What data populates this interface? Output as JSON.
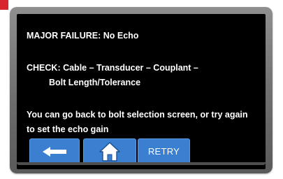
{
  "message": {
    "title": "MAJOR FAILURE: No Echo",
    "check_line1": "CHECK: Cable – Transducer – Couplant –",
    "check_line2": "Bolt Length/Tolerance",
    "note_line1": "You can go back to bolt selection screen, or try again",
    "note_line2": "to set the echo gain"
  },
  "buttons": {
    "back_icon": "left-arrow-icon",
    "home_icon": "home-icon",
    "retry_label": "RETRY"
  },
  "colors": {
    "screen_bg": "#000000",
    "button_blue": "#3b7fd1",
    "device_gray": "#7a7a7a",
    "accent_red": "#d8262e",
    "text": "#ffffff"
  }
}
